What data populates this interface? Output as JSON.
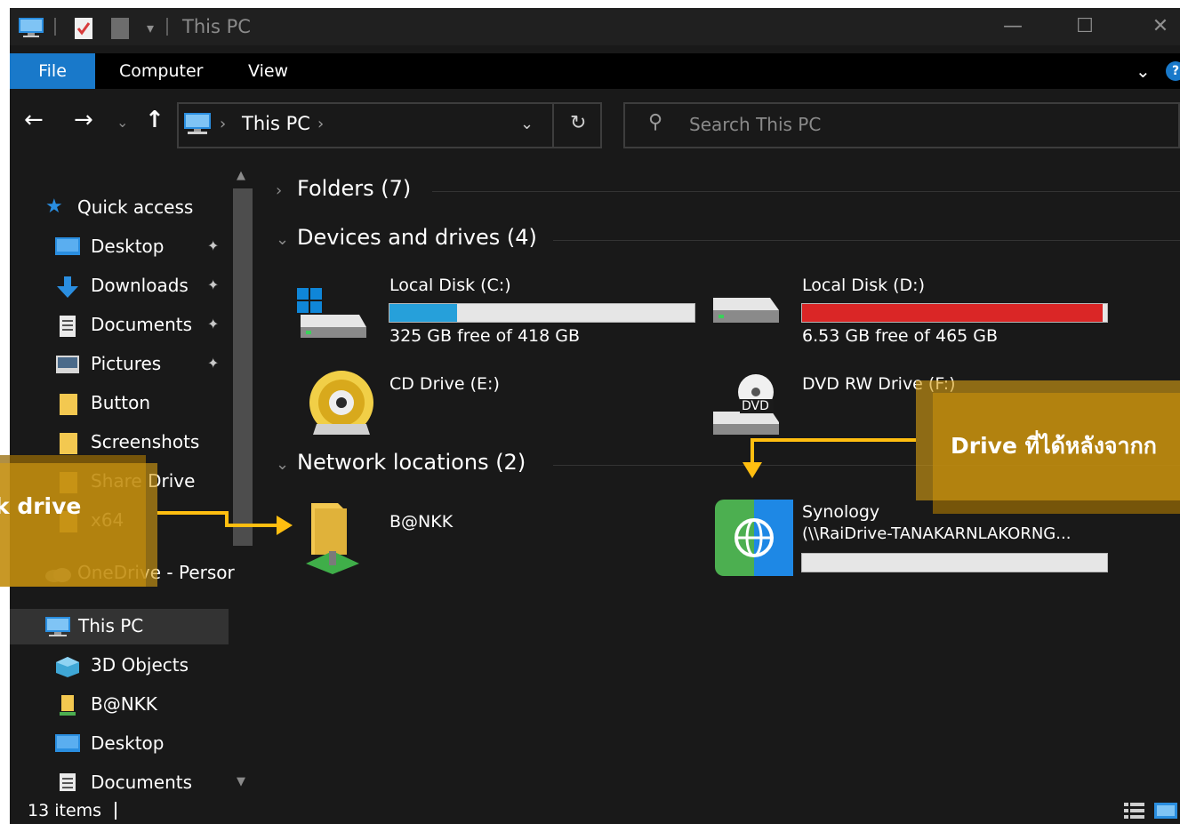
{
  "window": {
    "title": "This PC",
    "controls": {
      "minimize": "—",
      "maximize": "☐",
      "close": "✕"
    }
  },
  "ribbon": {
    "tabs": [
      "File",
      "Computer",
      "View"
    ],
    "collapse_glyph": "⌄",
    "help_glyph": "?"
  },
  "address": {
    "crumb": "This PC",
    "sep": "›",
    "drop": "⌄",
    "refresh": "↻"
  },
  "search": {
    "placeholder": "Search This PC",
    "glyph": "⚲"
  },
  "nav": {
    "back": "←",
    "forward": "→",
    "recent": "⌄",
    "up": "↑"
  },
  "sidebar": {
    "quick_access": "Quick access",
    "items": [
      {
        "label": "Desktop",
        "pinned": true,
        "icon": "desktop-icon"
      },
      {
        "label": "Downloads",
        "pinned": true,
        "icon": "download-arrow-icon"
      },
      {
        "label": "Documents",
        "pinned": true,
        "icon": "documents-icon"
      },
      {
        "label": "Pictures",
        "pinned": true,
        "icon": "pictures-icon"
      },
      {
        "label": "Button",
        "pinned": false,
        "icon": "folder-icon"
      },
      {
        "label": "Screenshots",
        "pinned": false,
        "icon": "folder-icon"
      },
      {
        "label": "Share Drive",
        "pinned": false,
        "icon": "folder-icon"
      },
      {
        "label": "x64",
        "pinned": false,
        "icon": "folder-icon"
      }
    ],
    "onedrive": "OneDrive - Persor",
    "this_pc": "This PC",
    "pc_children": [
      {
        "label": "3D Objects",
        "icon": "3d-objects-icon"
      },
      {
        "label": "B@NKK",
        "icon": "network-drive-icon"
      },
      {
        "label": "Desktop",
        "icon": "desktop-icon"
      },
      {
        "label": "Documents",
        "icon": "documents-icon"
      }
    ],
    "pin_glyph": "📌"
  },
  "content": {
    "groups": {
      "folders": "Folders (7)",
      "devices": "Devices and drives (4)",
      "network": "Network locations (2)"
    },
    "group_chevrons": {
      "collapsed": "›",
      "expanded": "⌄"
    },
    "drives": [
      {
        "name": "Local Disk (C:)",
        "free": "325 GB free of 418 GB",
        "used_fraction": 0.222,
        "icon": "windows-disk-icon"
      },
      {
        "name": "Local Disk (D:)",
        "free": "6.53 GB free of 465 GB",
        "used_fraction": 0.986,
        "icon": "hard-disk-icon"
      },
      {
        "name": "CD Drive (E:)",
        "icon": "cd-drive-icon"
      },
      {
        "name": "DVD RW Drive (F:)",
        "icon": "dvd-drive-icon",
        "badge": "DVD"
      }
    ],
    "network": [
      {
        "name": "B@NKK",
        "icon": "network-folder-icon"
      },
      {
        "name": "Synology",
        "path": "(\\\\RaiDrive-TANAKARNLAKORNG...",
        "used_fraction": 0,
        "icon": "raidrive-globe-icon"
      }
    ]
  },
  "status": {
    "items": "13 items"
  },
  "annotations": {
    "left_label": "k drive",
    "right_label": "Drive ที่ได้หลังจากก"
  },
  "colors": {
    "accent": "#1979ca",
    "bar_normal": "#26a0da",
    "bar_full": "#da2626",
    "annotation": "#d69e14",
    "arrow": "#ffbe10"
  }
}
